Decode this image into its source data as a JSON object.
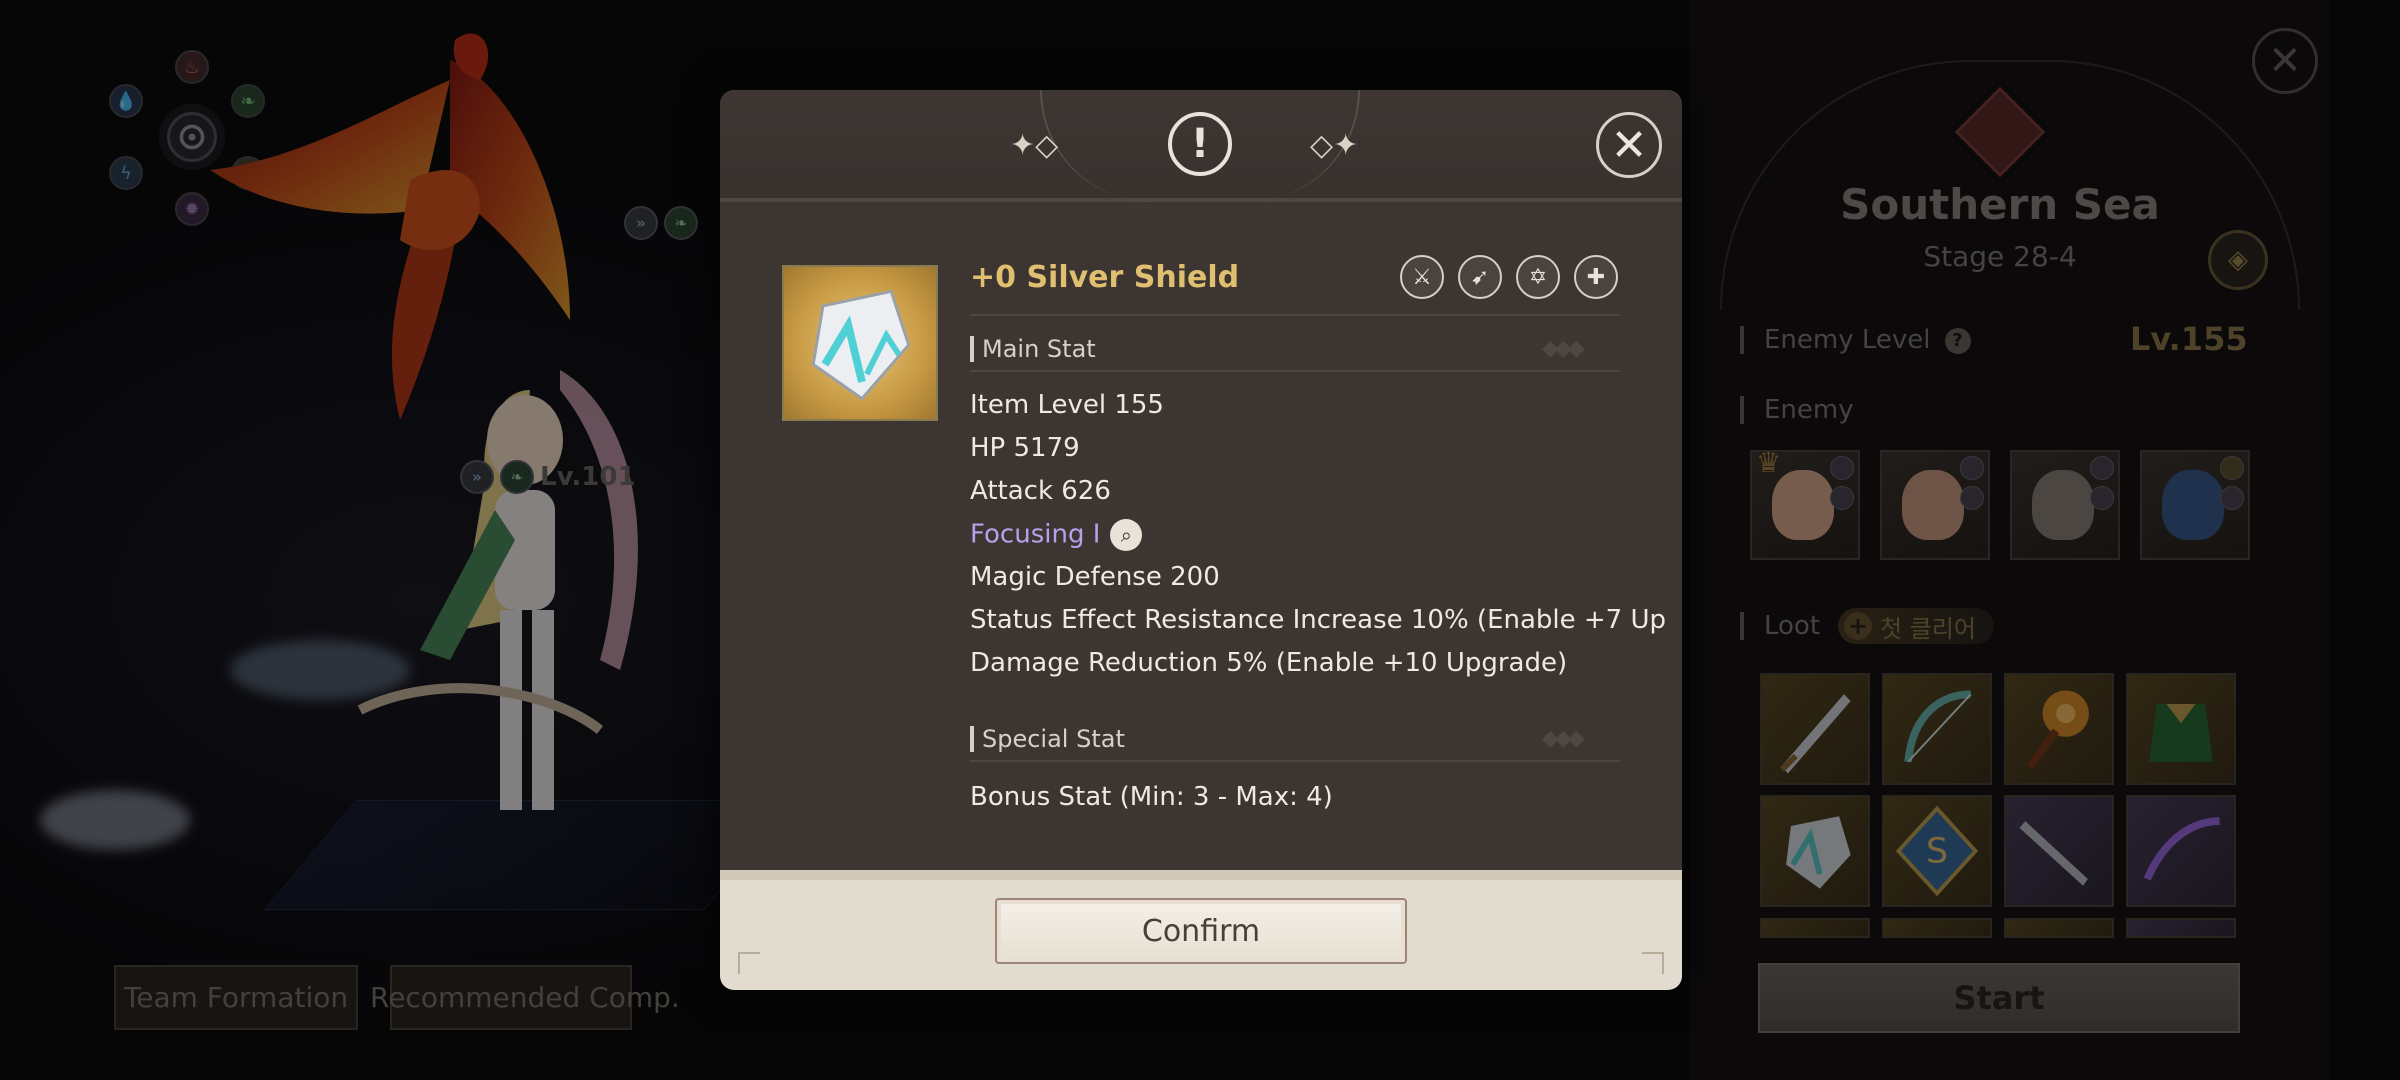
{
  "background": {
    "unit_level": "Lv.101",
    "buttons": {
      "team_formation": "Team Formation",
      "recommended": "Recommended Comp."
    }
  },
  "right_panel": {
    "region": "Southern Sea",
    "stage": "Stage 28-4",
    "enemy_level_label": "Enemy Level",
    "enemy_level_value": "Lv.155",
    "enemy_label": "Enemy",
    "loot_label": "Loot",
    "loot_badge": "첫 클리어",
    "start_label": "Start"
  },
  "modal": {
    "item_name": "+0 Silver Shield",
    "main_stat_label": "Main Stat",
    "stats": [
      "Item Level 155",
      "HP 5179",
      "Attack 626",
      "Focusing I",
      "Magic Defense 200",
      "Status Effect Resistance Increase 10% (Enable +7 Up",
      "Damage Reduction 5% (Enable +10 Upgrade)"
    ],
    "special_stat_label": "Special Stat",
    "special_stats": [
      "Bonus Stat (Min: 3 - Max: 4)"
    ],
    "confirm_label": "Confirm"
  },
  "colors": {
    "item_name": "#e0c070",
    "focusing": "#b9a0ea",
    "enemy_level": "#8e7a4a"
  }
}
